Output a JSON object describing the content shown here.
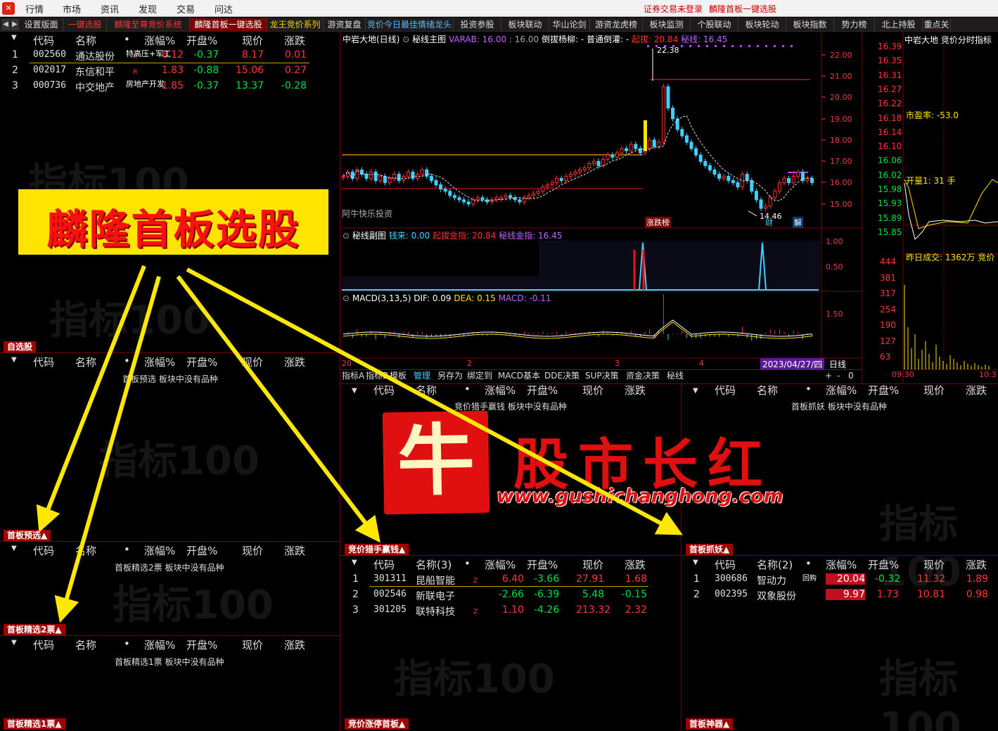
{
  "menu": {
    "items": [
      "行情",
      "市场",
      "资讯",
      "发现",
      "交易",
      "问达"
    ],
    "status_login": "证券交易未登录",
    "status_module": "麟隆首板一键选股"
  },
  "tabs": [
    {
      "label": "设置版面",
      "style": ""
    },
    {
      "label": "一键选股",
      "style": "red"
    },
    {
      "label": "麟隆至尊竞价系统",
      "style": "red"
    },
    {
      "label": "麟隆首板一键选股",
      "style": "act"
    },
    {
      "label": "龙王竞价系列",
      "style": "yel"
    },
    {
      "label": "游资复盘",
      "style": ""
    },
    {
      "label": "竞价今日最佳情绪龙头",
      "style": "blu"
    },
    {
      "label": "投资参股",
      "style": ""
    },
    {
      "label": "板块联动",
      "style": ""
    },
    {
      "label": "华山论剑",
      "style": ""
    },
    {
      "label": "游资龙虎榜",
      "style": ""
    },
    {
      "label": "板块监测",
      "style": ""
    },
    {
      "label": "个股联动",
      "style": ""
    },
    {
      "label": "板块轮动",
      "style": ""
    },
    {
      "label": "板块指数",
      "style": ""
    },
    {
      "label": "势力榜",
      "style": ""
    },
    {
      "label": "北上持股",
      "style": ""
    },
    {
      "label": "重点关",
      "style": ""
    }
  ],
  "columns": {
    "code": "代码",
    "name": "名称",
    "dot": "•",
    "pct": "涨幅%",
    "open": "开盘%",
    "price": "现价",
    "chg": "涨跌"
  },
  "watermark": "指标100",
  "topList": {
    "rows": [
      {
        "n": "1",
        "code": "002560",
        "name": "通达股份",
        "tag": "R",
        "pct": "8.12",
        "open": "-0.37",
        "price": "8.17",
        "chg": "0.01",
        "note": "特高压+军工"
      },
      {
        "n": "2",
        "code": "002017",
        "name": "东信和平",
        "tag": "R",
        "pct": "1.83",
        "open": "-0.88",
        "price": "15.06",
        "chg": "0.27",
        "note": ""
      },
      {
        "n": "3",
        "code": "000736",
        "name": "中交地产",
        "tag": "",
        "pct": "1.85",
        "open": "-0.37",
        "price": "13.37",
        "chg": "-0.28",
        "note": "房地产开发"
      }
    ],
    "label": "自选股"
  },
  "banner": "麟隆首板选股",
  "panels": {
    "p_a": {
      "label": "首板预选▲",
      "empty": "首板预选 板块中没有品种"
    },
    "p_b": {
      "label": "首板精选2票▲",
      "empty": "首板精选2票 板块中没有品种"
    },
    "p_c": {
      "label": "首板精选1票▲",
      "empty": "首板精选1票 板块中没有品种"
    },
    "p_d": {
      "label": "竞价猎手赢钱▲",
      "empty": "竞价猎手赢钱 板块中没有品种",
      "name_hdr": "名称(3)",
      "rows": [
        {
          "n": "1",
          "code": "301311",
          "name": "昆船智能",
          "tag": "Z",
          "pct": "6.40",
          "open": "-3.66",
          "price": "27.91",
          "chg": "1.68"
        },
        {
          "n": "2",
          "code": "002546",
          "name": "新联电子",
          "tag": "",
          "pct": "-2.66",
          "open": "-6.39",
          "price": "5.48",
          "chg": "-0.15"
        },
        {
          "n": "3",
          "code": "301205",
          "name": "联特科技",
          "tag": "Z",
          "pct": "1.10",
          "open": "-4.26",
          "price": "213.32",
          "chg": "2.32"
        }
      ]
    },
    "p_e": {
      "label": "竞价涨停首板▲"
    },
    "p_f": {
      "label": "首板抓妖▲",
      "empty": "首板抓妖 板块中没有品种"
    },
    "p_g": {
      "label": "首板抓妖▲",
      "name_hdr": "名称(2)",
      "rows": [
        {
          "n": "1",
          "code": "300686",
          "name": "智动力",
          "tag": "回购",
          "pct": "20.04",
          "open": "-0.32",
          "price": "11.32",
          "chg": "1.89"
        },
        {
          "n": "2",
          "code": "002395",
          "name": "双象股份",
          "tag": "",
          "pct": "9.97",
          "open": "1.73",
          "price": "10.81",
          "chg": "0.98"
        }
      ]
    },
    "p_h": {
      "label": "首板神器▲"
    }
  },
  "mainChart": {
    "title": "中岩大地(日线)",
    "indicator": "秘线主图",
    "varab": "VARAB: 16.00",
    "varab2": ": 16.00",
    "fall": "倒拔杨柳: -",
    "normal": "普通倒灌: -",
    "qiba": "起拔: 20.84",
    "mixian": "秘线: 16.45",
    "high": "22.38",
    "low": "14.46",
    "source": "阿牛快乐投资",
    "labels": [
      "涨跌榜",
      "财",
      "解"
    ],
    "yaxis": [
      "22.00",
      "21.00",
      "20.00",
      "19.00",
      "18.00",
      "17.00",
      "16.00",
      "15.00"
    ]
  },
  "subChart1": {
    "title": "秘线副图",
    "qianlai": "钱来: 0.00",
    "qiba": "起拔金指: 20.84",
    "mixian": "秘线金指: 16.45",
    "yaxis": [
      "1.00",
      "0.50"
    ]
  },
  "macd": {
    "title": "MACD(3,13,5)",
    "dif": "DIF: 0.09",
    "dea": "DEA: 0.15",
    "macd": "MACD: -0.11",
    "yaxis": "1.50"
  },
  "xaxis": {
    "ticks": [
      "20",
      "2",
      "3",
      "4"
    ],
    "date": "2023/04/27/四",
    "period": "日线"
  },
  "toolbar": [
    "指标A",
    "指标B",
    "模板",
    "管理",
    "另存为",
    "绑定到",
    "MACD基本",
    "DDE决策",
    "SUP决策",
    "资金决策",
    "秘线"
  ],
  "toolbarRight": [
    "+",
    "-",
    "0"
  ],
  "rightPanel": {
    "title": "中岩大地",
    "subtitle": "竞价分时指标",
    "prices": [
      "16.39",
      "16.35",
      "16.31",
      "16.27",
      "16.22",
      "16.18",
      "16.14",
      "16.10",
      "16.06",
      "16.02",
      "15.98",
      "15.93",
      "15.89",
      "15.85"
    ],
    "pe": "市盈率: -53.0",
    "kailiang": "开量1:  31 手",
    "zuori": "昨日成交: 1362万 竞价",
    "vol": [
      "444",
      "381",
      "317",
      "254",
      "190",
      "127",
      "63"
    ],
    "times": [
      "09:30",
      "10:3"
    ]
  },
  "brand": {
    "logo": "牛",
    "name": "股市长红",
    "url": "www.gushichanghong.com"
  },
  "chart_data": [
    {
      "type": "line",
      "title": "中岩大地(日线)",
      "ylim": [
        14.46,
        22.38
      ],
      "series": [
        {
          "name": "秘线",
          "values": [
            16.45
          ]
        },
        {
          "name": "起拔",
          "values": [
            20.84
          ]
        }
      ]
    },
    {
      "type": "bar",
      "title": "MACD(3,13,5)",
      "series": [
        {
          "name": "DIF",
          "values": [
            0.09
          ]
        },
        {
          "name": "DEA",
          "values": [
            0.15
          ]
        },
        {
          "name": "MACD",
          "values": [
            -0.11
          ]
        }
      ]
    }
  ]
}
